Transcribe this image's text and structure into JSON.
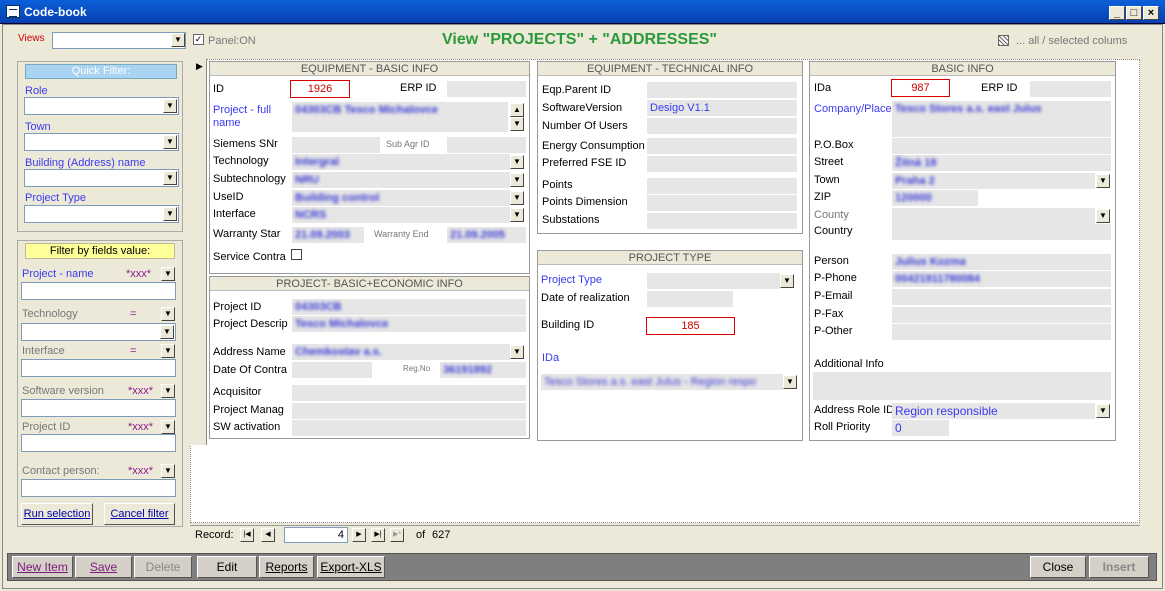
{
  "window": {
    "title": "Code-book"
  },
  "toolbar": {
    "views_label": "Views",
    "panel_label": "Panel:ON",
    "view_title": "View \"PROJECTS\" + \"ADDRESSES\"",
    "columns_label": "... all / selected colums"
  },
  "quick_filter": {
    "header": "Quick Filter:",
    "role": "Role",
    "town": "Town",
    "building": "Building (Address) name",
    "project_type": "Project Type"
  },
  "field_filter": {
    "header": "Filter by fields value:",
    "project_name": "Project - name",
    "project_name_op": "*xxx*",
    "technology": "Technology",
    "technology_op": "=",
    "interface": "Interface",
    "interface_op": "=",
    "software_version": "Software version",
    "software_version_op": "*xxx*",
    "project_id": "Project ID",
    "project_id_op": "*xxx*",
    "contact_person": "Contact person:",
    "contact_person_op": "*xxx*",
    "run_selection": "Run selection",
    "cancel_filter": "Cancel filter"
  },
  "equipment_basic": {
    "header": "EQUIPMENT - BASIC INFO",
    "id_label": "ID",
    "id_value": "1926",
    "erp_label": "ERP ID",
    "project_full_label": "Project - full name",
    "project_full_value": "04303CB Tesco Michalovce",
    "siemens_snr": "Siemens SNr",
    "sub_agr_id": "Sub Agr ID",
    "technology": "Technology",
    "technology_value": "Intergral",
    "subtechnology": "Subtechnology",
    "subtechnology_value": "NRU",
    "useid": "UseID",
    "useid_value": "Building control",
    "interface": "Interface",
    "interface_value": "NCRS",
    "warranty_start": "Warranty Star",
    "warranty_start_value": "21.09.2003",
    "warranty_end": "Warranty End",
    "warranty_end_value": "21.09.2005",
    "service_contract": "Service Contra"
  },
  "project_basic": {
    "header": "PROJECT- BASIC+ECONOMIC INFO",
    "project_id": "Project ID",
    "project_id_value": "04303CB",
    "project_descr": "Project Descrip",
    "project_descr_value": "Tesco Michalovce",
    "address_name": "Address Name",
    "address_name_value": "Chemkostav a.s.",
    "date_contract": "Date Of Contra",
    "reg_no": "Reg.No",
    "reg_no_value": "36191892",
    "acquisitor": "Acquisitor",
    "project_manager": "Project Manag",
    "sw_activation": "SW activation"
  },
  "equipment_tech": {
    "header": "EQUIPMENT - TECHNICAL INFO",
    "eqp_parent": "Eqp.Parent ID",
    "software_version": "SoftwareVersion",
    "software_version_value": "Desigo V1.1",
    "number_users": "Number Of Users",
    "energy": "Energy Consumption",
    "preferred_fse": "Preferred FSE ID",
    "points": "Points",
    "points_dimension": "Points Dimension",
    "substations": "Substations"
  },
  "project_type": {
    "header": "PROJECT TYPE",
    "project_type": "Project Type",
    "date_realization": "Date of realization",
    "building_id": "Building ID",
    "building_id_value": "185",
    "ida": "IDa",
    "ida_value": "Tesco Stores a.s. east Julus - Region respo"
  },
  "basic_info": {
    "header": "BASIC INFO",
    "ida": "IDa",
    "ida_value": "987",
    "erp": "ERP ID",
    "company": "Company/Place:",
    "company_value": "Tesco Stores a.s. east Julus",
    "pobox": "P.O.Box",
    "street": "Street",
    "street_value": "Žitná 18",
    "town": "Town",
    "town_value": "Praha 2",
    "zip": "ZIP",
    "zip_value": "120000",
    "county": "County",
    "country": "Country",
    "person": "Person",
    "person_value": "Julius Kozma",
    "p_phone": "P-Phone",
    "p_phone_value": "00421911780084",
    "p_email": "P-Email",
    "p_fax": "P-Fax",
    "p_other": "P-Other",
    "additional": "Additional Info",
    "address_role": "Address Role ID",
    "address_role_value": "Region responsible",
    "roll_priority": "Roll Priority",
    "roll_priority_value": "0"
  },
  "record_nav": {
    "label": "Record:",
    "current": "4",
    "of": "of",
    "total": "627"
  },
  "bottom": {
    "new_item": "New Item",
    "save": "Save",
    "delete": "Delete",
    "edit": "Edit",
    "reports": "Reports",
    "export": "Export-XLS",
    "close": "Close",
    "insert": "Insert"
  }
}
